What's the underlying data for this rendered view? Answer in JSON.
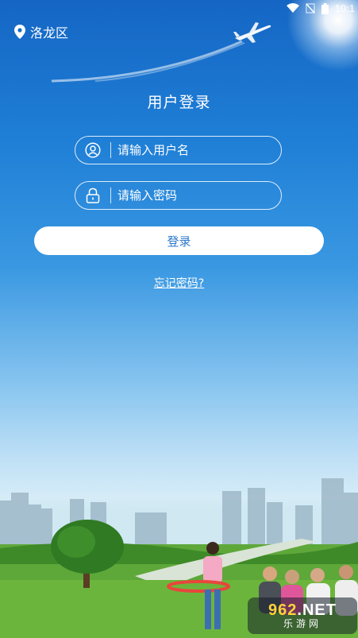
{
  "status_bar": {
    "time": "10:1",
    "icons": [
      "wifi-icon",
      "no-signal-icon",
      "battery-icon"
    ]
  },
  "location": {
    "name": "洛龙区",
    "icon": "location-pin-icon"
  },
  "login": {
    "title": "用户登录",
    "username_placeholder": "请输入用户名",
    "username_icon": "user-icon",
    "password_placeholder": "请输入密码",
    "password_icon": "lock-icon",
    "submit_label": "登录",
    "forgot_label": "忘记密码?"
  },
  "watermark": {
    "top_prefix": "962",
    "top_suffix": ".NET",
    "bottom": "乐游网"
  },
  "colors": {
    "sky_top": "#1566c4",
    "button_text": "#2a78c8",
    "grass": "#4f9a2a"
  }
}
